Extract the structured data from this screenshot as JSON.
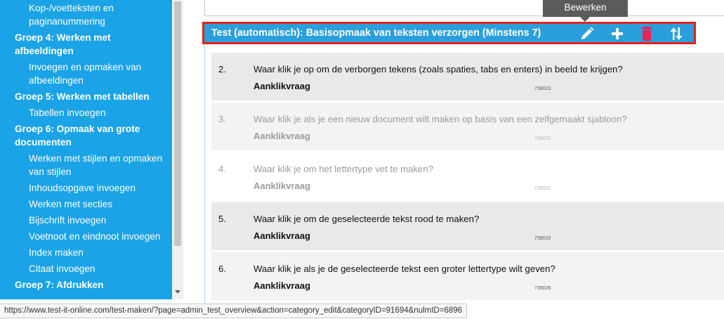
{
  "sidebar": {
    "items": [
      {
        "label": "Kop-/voetteksten en paginanummering",
        "type": "item"
      },
      {
        "label": "Groep 4: Werken met afbeeldingen",
        "type": "group"
      },
      {
        "label": "Invoegen en opmaken van afbeeldingen",
        "type": "item"
      },
      {
        "label": "Groep 5: Werken met tabellen",
        "type": "group"
      },
      {
        "label": "Tabellen invoegen",
        "type": "item"
      },
      {
        "label": "Groep 6: Opmaak van grote documenten",
        "type": "group"
      },
      {
        "label": "Werken met stijlen en opmaken van stijlen",
        "type": "item"
      },
      {
        "label": "Inhoudsopgave invoegen",
        "type": "item"
      },
      {
        "label": "Werken met secties",
        "type": "item"
      },
      {
        "label": "Bijschrift invoegen",
        "type": "item"
      },
      {
        "label": "Voetnoot en eindnoot invoegen",
        "type": "item"
      },
      {
        "label": "Index maken",
        "type": "item"
      },
      {
        "label": "Citaat invoegen",
        "type": "item"
      },
      {
        "label": "Groep 7: Afdrukken",
        "type": "group"
      }
    ]
  },
  "tooltip": {
    "text": "Bewerken"
  },
  "category": {
    "title": "Test (automatisch): Basisopmaak van teksten verzorgen (Minstens 7)",
    "actions": {
      "edit_icon": "pencil-icon",
      "add_icon": "plus-icon",
      "delete_icon": "trash-icon",
      "sort_icon": "sort-arrows-icon"
    }
  },
  "questions": [
    {
      "number": "2.",
      "text": "Waar klik je op om de verborgen tekens (zoals spaties, tabs en enters) in beeld te krijgen?",
      "type": "Aanklikvraag",
      "id": "739023",
      "active": true
    },
    {
      "number": "3.",
      "text": "Waar klik je als je een nieuw document wilt maken op basis van een zelfgemaakt sjabloon?",
      "type": "Aanklikvraag",
      "id": "739022",
      "active": false
    },
    {
      "number": "4.",
      "text": "Waar klik je om het lettertype vet te maken?",
      "type": "Aanklikvraag",
      "id": "739021",
      "active": false
    },
    {
      "number": "5.",
      "text": "Waar klik je om de geselecteerde tekst rood te maken?",
      "type": "Aanklikvraag",
      "id": "739020",
      "active": true
    },
    {
      "number": "6.",
      "text": "Waar klik je als je de geselecteerde tekst een groter lettertype wilt geven?",
      "type": "Aanklikvraag",
      "id": "739026",
      "active": true
    }
  ],
  "status_bar": {
    "url": "https://www.test-it-online.com/test-maken/?page=admin_test_overview&action=category_edit&categoryID=91694&nulmID=6896"
  },
  "colors": {
    "sidebar_bg": "#1aa3e6",
    "header_bg": "#2b9fdc",
    "highlight_border": "#e2231a",
    "delete_icon": "#e8245a"
  }
}
